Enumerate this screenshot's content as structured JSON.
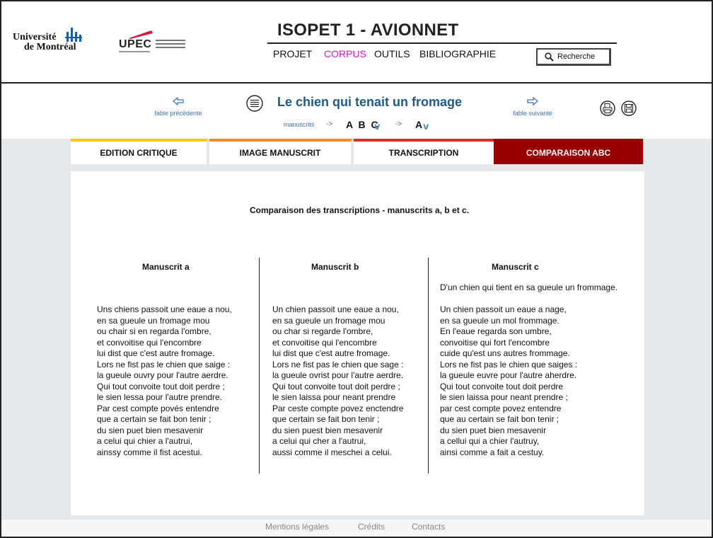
{
  "header": {
    "logo_udem": {
      "line1": "Université",
      "line2": "de Montréal"
    },
    "logo_upec": {
      "text": "UPEC"
    },
    "site_title": "ISOPET 1 - AVIONNET",
    "nav": {
      "projet": "PROJET",
      "corpus": "CORPUS",
      "outils": "OUTILS",
      "bibliographie": "BIBLIOGRAPHIE",
      "active_color": "#e20fcf"
    },
    "search_label": "Recherche"
  },
  "fable_bar": {
    "prev_label": "fable précédente",
    "next_label": "fable suivante",
    "title": "Le chien qui tenait un fromage",
    "manuscripts_label": "manuscrits",
    "arrow": "->",
    "ms_letters": "A B C",
    "ms_selected": "A",
    "chevron": "v"
  },
  "tabs": {
    "edition": "EDITION CRITIQUE",
    "image": "IMAGE MANUSCRIT",
    "transcription": "TRANSCRIPTION",
    "comparaison": "COMPARAISON ABC",
    "colors": {
      "edition": "#f7c80c",
      "image": "#ef8a2e",
      "transcription": "#e02a2a",
      "comparaison": "#9a0000"
    }
  },
  "content": {
    "title": "Comparaison des transcriptions - manuscrits a, b et c.",
    "manuscripts": [
      {
        "heading": "Manuscrit a",
        "lines": [
          "Uns chiens passoit une eaue a nou,",
          "en sa gueule un fromage mou",
          "ou chair si en regarda l'ombre,",
          "et convoitise qui l'encombre",
          "lui dist que c'est autre fromage.",
          "Lors ne fist pas le chien que saige :",
          "la gueule ouvry pour l'autre aerdre.",
          "Qui tout convoite tout doit perdre ;",
          "le sien lessa pour l'autre prendre.",
          "Par cest compte povés entendre",
          "que a certain se fait bon tenir ;",
          "du sien puet bien mesavenir",
          "a celui qui chier a l'autrui,",
          "ainssy comme il fist acestui."
        ]
      },
      {
        "heading": "Manuscrit b",
        "lines": [
          "Un chien passoit une eaue a nou,",
          "en sa gueule un fromage mou",
          "ou char si regarde l'ombre,",
          "et convoitise qui l'encombre",
          "lui dist que c'est autre fromage.",
          "Lors ne fist pas le chien que sage :",
          "la gueule ovrist pour l'autre aerdre.",
          "Qui tout convoite tout doit perdre ;",
          "le sien laissa pour neant prendre",
          "Par ceste compte povez enctendre",
          "que certain se fait bon tenir ;",
          "du sien puest bien mesavenir",
          "a celui qui cher a l'autrui,",
          "aussi comme il meschei a celui."
        ]
      },
      {
        "heading": "Manuscrit c",
        "subtitle": "D'un chien qui tient en sa gueule un frommage.",
        "lines": [
          "Un chien passoit un eaue a nage,",
          "en sa gueule un mol frommage.",
          "En l'eaue regarda son umbre,",
          "convoitise qui fort l'encombre",
          "cuide qu'est uns autres frommage.",
          "Lors ne fist pas le chien que saiges :",
          "la gueule euvre pour l'autre aherdre.",
          "Qui tout convoite tout doit perdre",
          "le sien laissa pour neant prendre ;",
          "par cest compte povez entendre",
          "que au certain se fait bon tenir ;",
          "du sien puet bien mesavenir",
          "a cellui qui a chier l'autruy,",
          "ainsi comme a fait a cestuy."
        ]
      }
    ]
  },
  "footer": {
    "mentions": "Mentions légales",
    "credits": "Crédits",
    "contacts": "Contacts"
  }
}
